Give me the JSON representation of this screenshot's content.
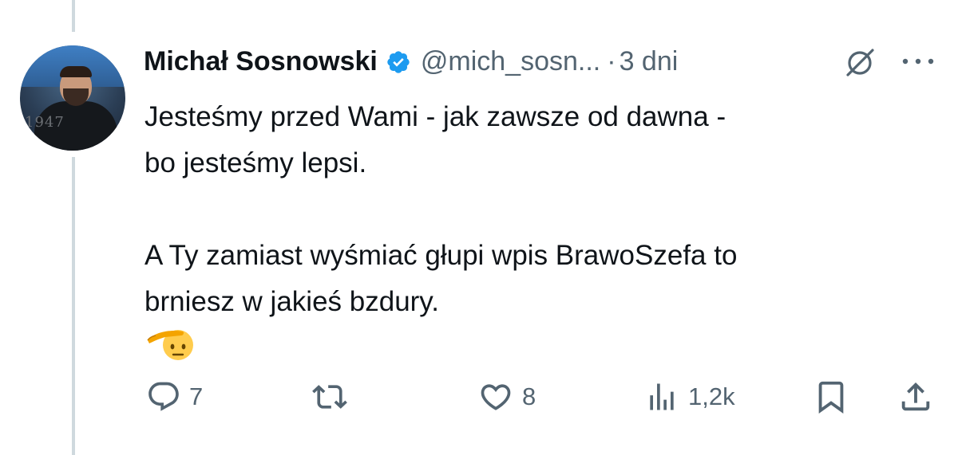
{
  "tweet": {
    "author_name": "Michał Sosnowski",
    "handle": "@mich_sosn...",
    "separator": "·",
    "time": "3 dni",
    "lines": [
      "Jesteśmy przed Wami - jak zawsze od dawna -",
      "bo jesteśmy lepsi.",
      "",
      "A Ty zamiast wyśmiać głupi wpis BrawoSzefa to",
      "brniesz w jakieś bzdury."
    ],
    "emoji": "saluting-face",
    "avatar_text": "1947"
  },
  "actions": {
    "replies": "7",
    "reposts": "",
    "likes": "8",
    "views": "1,2k"
  },
  "colors": {
    "text": "#0f1419",
    "secondary": "#536471",
    "verified": "#1d9bf0",
    "thread_line": "#cfd9de"
  },
  "icons": [
    "verified-badge-icon",
    "grok-icon",
    "more-icon",
    "reply-icon",
    "repost-icon",
    "like-icon",
    "views-icon",
    "bookmark-icon",
    "share-icon"
  ]
}
